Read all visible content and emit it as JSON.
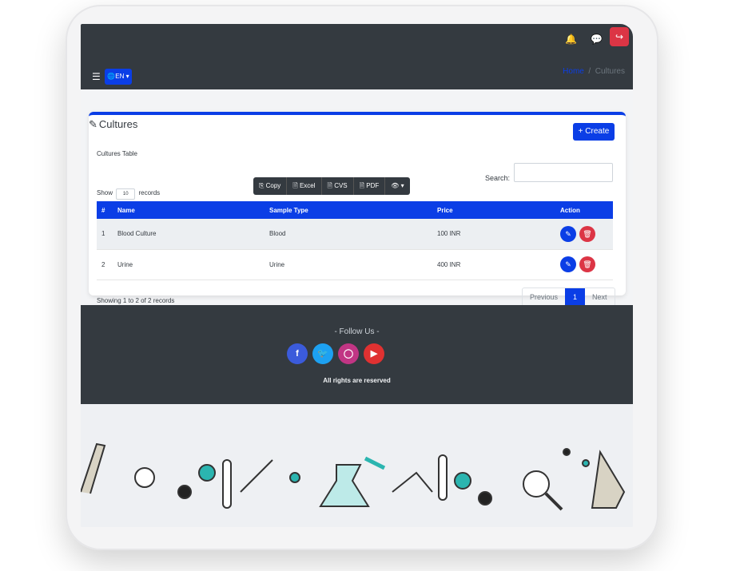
{
  "header": {
    "lang_label": "EN",
    "menu_icon": "hamburger-icon",
    "bell_icon": "bell-icon",
    "chat_icon": "chat-icon",
    "logout_icon": "logout-icon"
  },
  "breadcrumb": {
    "home": "Home",
    "sep": "/",
    "current": "Cultures"
  },
  "page": {
    "title": "Cultures",
    "create_label": "Create",
    "table_title": "Cultures Table"
  },
  "table_controls": {
    "show_label": "Show",
    "records_label": "records",
    "page_size": "10",
    "search_label": "Search:",
    "search_value": ""
  },
  "export_buttons": {
    "copy": "Copy",
    "excel": "Excel",
    "csv": "CVS",
    "pdf": "PDF"
  },
  "table": {
    "headers": [
      "#",
      "Name",
      "Sample Type",
      "Price",
      "Action"
    ],
    "rows": [
      {
        "num": "1",
        "name": "Blood Culture",
        "sample": "Blood",
        "price": "100 INR"
      },
      {
        "num": "2",
        "name": "Urine",
        "sample": "Urine",
        "price": "400 INR"
      }
    ]
  },
  "footer_table": {
    "showing": "Showing 1 to 2 of 2 records",
    "prev": "Previous",
    "page": "1",
    "next": "Next"
  },
  "footer": {
    "follow": "- Follow Us -",
    "rights": "All rights are reserved",
    "socials": [
      "facebook-icon",
      "twitter-icon",
      "instagram-icon",
      "youtube-icon"
    ]
  },
  "colors": {
    "primary": "#0b3ee6",
    "danger": "#dc3545",
    "dark": "#343a40"
  }
}
